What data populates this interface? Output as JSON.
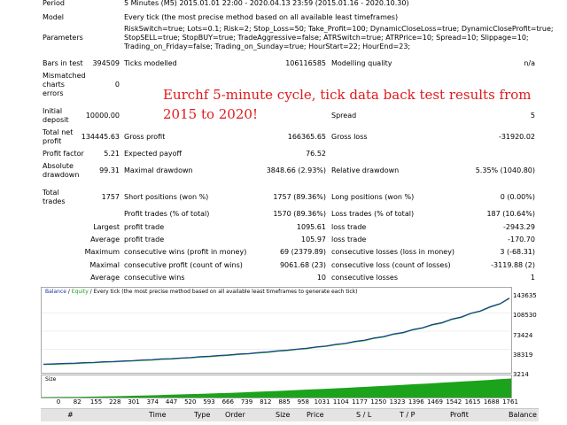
{
  "rows": {
    "period": {
      "label": "Period",
      "value": "5 Minutes (M5) 2015.01.01 22:00 - 2020.04.13 23:59 (2015.01.16 - 2020.10.30)"
    },
    "model": {
      "label": "Model",
      "value": "Every tick (the most precise method based on all available least timeframes)"
    },
    "parameters": {
      "label": "Parameters",
      "lines": [
        "RiskSwitch=true; Lots=0.1; Risk=2; Stop_Loss=50; Take_Profit=100; DynamicCloseLoss=true; DynamicCloseProfit=true;",
        "StopSELL=true; StopBUY=true; TradeAggressive=false; ATRSwitch=true; ATRPrice=10; Spread=10; Slippage=10;",
        "Trading_on_Friday=false; Trading_on_Sunday=true; HourStart=22; HourEnd=23;"
      ]
    },
    "bars": {
      "label": "Bars in test",
      "value": "394509",
      "ticks_label": "Ticks modelled",
      "ticks_value": "106116585",
      "quality_label": "Modelling quality",
      "quality_value": "n/a"
    },
    "mismatched": {
      "label1": "Mismatched",
      "label2": "charts",
      "label3": "errors",
      "value": "0"
    },
    "initial": {
      "label1": "Initial",
      "label2": "deposit",
      "value": "10000.00",
      "spread_label": "Spread",
      "spread_value": "5"
    },
    "netprofit": {
      "label1": "Total net",
      "label2": "profit",
      "value": "134445.63",
      "gp_label": "Gross profit",
      "gp_value": "166365.65",
      "gl_label": "Gross loss",
      "gl_value": "-31920.02"
    },
    "pf": {
      "label": "Profit factor",
      "value": "5.21",
      "ep_label": "Expected payoff",
      "ep_value": "76.52"
    },
    "dd": {
      "label1": "Absolute",
      "label2": "drawdown",
      "value": "99.31",
      "md_label": "Maximal drawdown",
      "md_value": "3848.66 (2.93%)",
      "rd_label": "Relative drawdown",
      "rd_value": "5.35% (1040.80)"
    },
    "trades": {
      "label1": "Total",
      "label2": "trades",
      "value": "1757",
      "sp_label": "Short positions (won %)",
      "sp_value": "1757 (89.36%)",
      "lp_label": "Long positions (won %)",
      "lp_value": "0 (0.00%)"
    },
    "pt": {
      "label": "Profit trades (% of total)",
      "value": "1570 (89.36%)",
      "lt_label": "Loss trades (% of total)",
      "lt_value": "187 (10.64%)"
    },
    "largest": {
      "prefix": "Largest",
      "p_label": "profit trade",
      "p_value": "1095.61",
      "l_label": "loss trade",
      "l_value": "-2943.29"
    },
    "average": {
      "prefix": "Average",
      "p_label": "profit trade",
      "p_value": "105.97",
      "l_label": "loss trade",
      "l_value": "-170.70"
    },
    "maxcons": {
      "prefix": "Maximum",
      "p_label": "consecutive wins (profit in money)",
      "p_value": "69 (2379.89)",
      "l_label": "consecutive losses (loss in money)",
      "l_value": "3 (-68.31)"
    },
    "maximal": {
      "prefix": "Maximal",
      "p_label": "consecutive profit (count of wins)",
      "p_value": "9061.68 (23)",
      "l_label": "consecutive loss (count of losses)",
      "l_value": "-3119.88 (2)"
    },
    "avgcons": {
      "prefix": "Average",
      "p_label": "consecutive wins",
      "p_value": "10",
      "l_label": "consecutive losses",
      "l_value": "1"
    }
  },
  "annotation": "Eurchf 5-minute cycle, tick data back test results from 2015 to 2020!",
  "chart": {
    "legend_balance": "Balance",
    "legend_sep": " / ",
    "legend_equity": "Equity",
    "legend_rest": " / Every tick (the most precise method based on all available least timeframes to generate each tick)",
    "balance_color": "#1a2fa8",
    "equity_color": "#17a317",
    "y_labels": [
      "143635",
      "108530",
      "73424",
      "38319"
    ],
    "size_label": "Size",
    "size_value_label": "3214",
    "size_color": "#1ca31c",
    "x_labels": [
      "0",
      "82",
      "155",
      "228",
      "301",
      "374",
      "447",
      "520",
      "593",
      "666",
      "739",
      "812",
      "885",
      "958",
      "1031",
      "1104",
      "1177",
      "1250",
      "1323",
      "1396",
      "1469",
      "1542",
      "1615",
      "1688",
      "1761"
    ]
  },
  "table_headers": [
    "#",
    "Time",
    "Type",
    "Order",
    "Size",
    "Price",
    "S / L",
    "T / P",
    "Profit",
    "Balance"
  ],
  "chart_data": {
    "type": "line",
    "series": [
      {
        "name": "Balance",
        "x": [
          0,
          82,
          155,
          228,
          301,
          374,
          447,
          520,
          593,
          666,
          739,
          812,
          885,
          958,
          1031,
          1104,
          1177,
          1250,
          1323,
          1396,
          1469,
          1542,
          1615,
          1688,
          1761
        ],
        "values": [
          10000,
          11500,
          13000,
          14800,
          16500,
          18500,
          20500,
          22500,
          25000,
          27500,
          30500,
          33500,
          37000,
          40500,
          45000,
          50000,
          56000,
          63000,
          71000,
          80000,
          90000,
          101000,
          113000,
          126000,
          143635
        ]
      }
    ],
    "ylim": [
      3214,
      150000
    ]
  }
}
